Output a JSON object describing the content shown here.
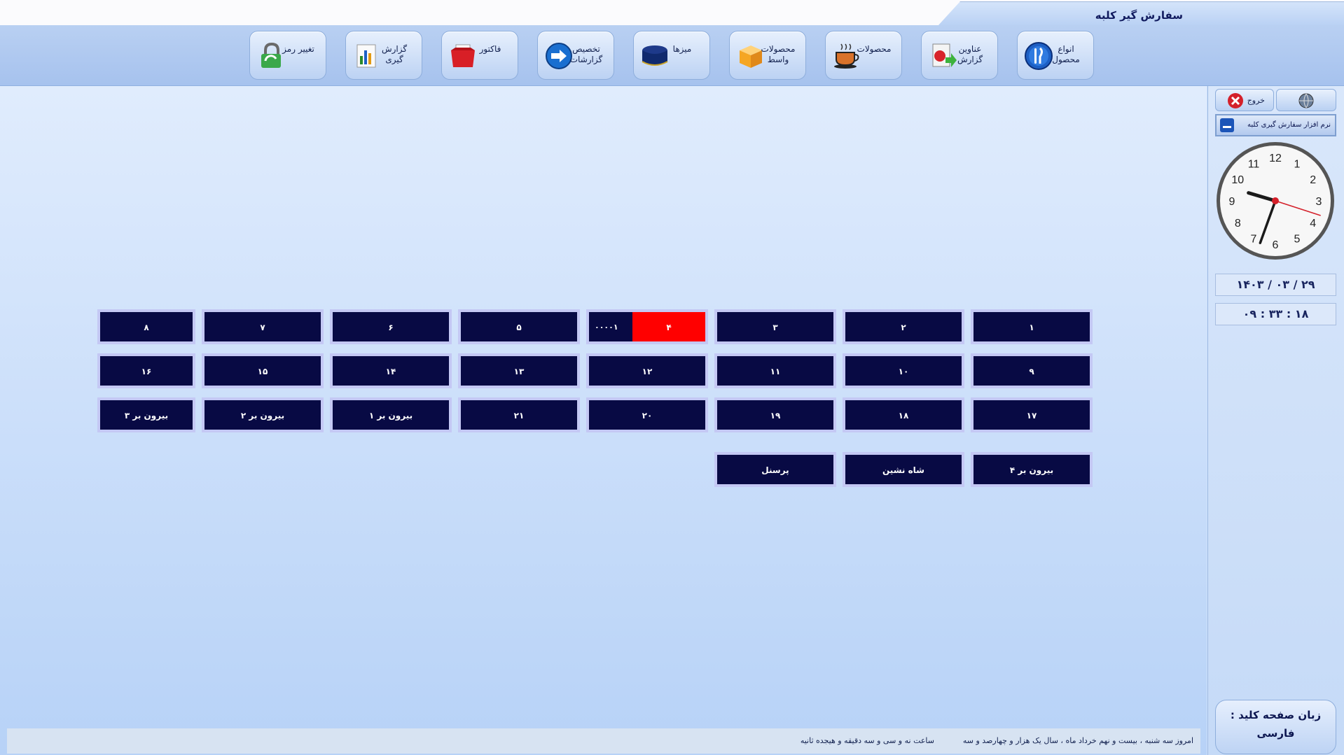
{
  "window": {
    "title": "سفارش گیر کلبه"
  },
  "toolbar": {
    "items": [
      {
        "label": "انواع محصول",
        "icon": "utensils-icon"
      },
      {
        "label": "عناوین گزارش",
        "icon": "report-titles-icon"
      },
      {
        "label": "محصولات",
        "icon": "coffee-cup-icon"
      },
      {
        "label": "محصولات واسط",
        "icon": "box-icon"
      },
      {
        "label": "میزها",
        "icon": "table-icon"
      },
      {
        "label": "تخصیص گزارشات",
        "icon": "arrow-assign-icon"
      },
      {
        "label": "فاکتور",
        "icon": "invoice-folder-icon"
      },
      {
        "label": "گزارش گیری",
        "icon": "bar-chart-icon"
      },
      {
        "label": "تغییر رمز",
        "icon": "lock-icon"
      }
    ]
  },
  "tables": {
    "rows": [
      [
        "۱",
        "۲",
        "۳",
        "۴",
        "۵",
        "۶",
        "۷",
        "۸"
      ],
      [
        "۹",
        "۱۰",
        "۱۱",
        "۱۲",
        "۱۳",
        "۱۴",
        "۱۵",
        "۱۶"
      ],
      [
        "۱۷",
        "۱۸",
        "۱۹",
        "۲۰",
        "۲۱",
        "بیرون بر ۱",
        "بیرون بر ۲",
        "بیرون بر ۳"
      ],
      [
        "بیرون بر ۴",
        "شاه نشین",
        "پرسنل"
      ]
    ],
    "busy": {
      "label": "۴",
      "code": "۰۰۰۰۱",
      "color": "#ff0000"
    }
  },
  "sidebar": {
    "exit_label": "خروج",
    "app_label": "نرم افزار سفارش گیری کلبه",
    "clock_numbers": [
      "12",
      "1",
      "2",
      "3",
      "4",
      "5",
      "6",
      "7",
      "8",
      "9",
      "10",
      "11"
    ],
    "clock_time": {
      "hours": 9,
      "minutes": 33,
      "seconds": 18
    },
    "date": "۱۴۰۳ / ۰۳ / ۲۹",
    "time": "۰۹ : ۳۳ : ۱۸",
    "keyboard_label": "زبان صفحه کلید :",
    "keyboard_value": "فارسی"
  },
  "status": {
    "date_text": "امروز سه شنبه ، بیست و نهم خرداد ماه ، سال یک هزار  و چهارصد و سه",
    "time_text": "ساعت نه و سی و سه دقیقه  و هیجده ثانیه"
  },
  "colors": {
    "tile": "#080a44",
    "tile_border": "#c4c8f4",
    "busy": "#ff0000",
    "accent": "#101a5e"
  }
}
